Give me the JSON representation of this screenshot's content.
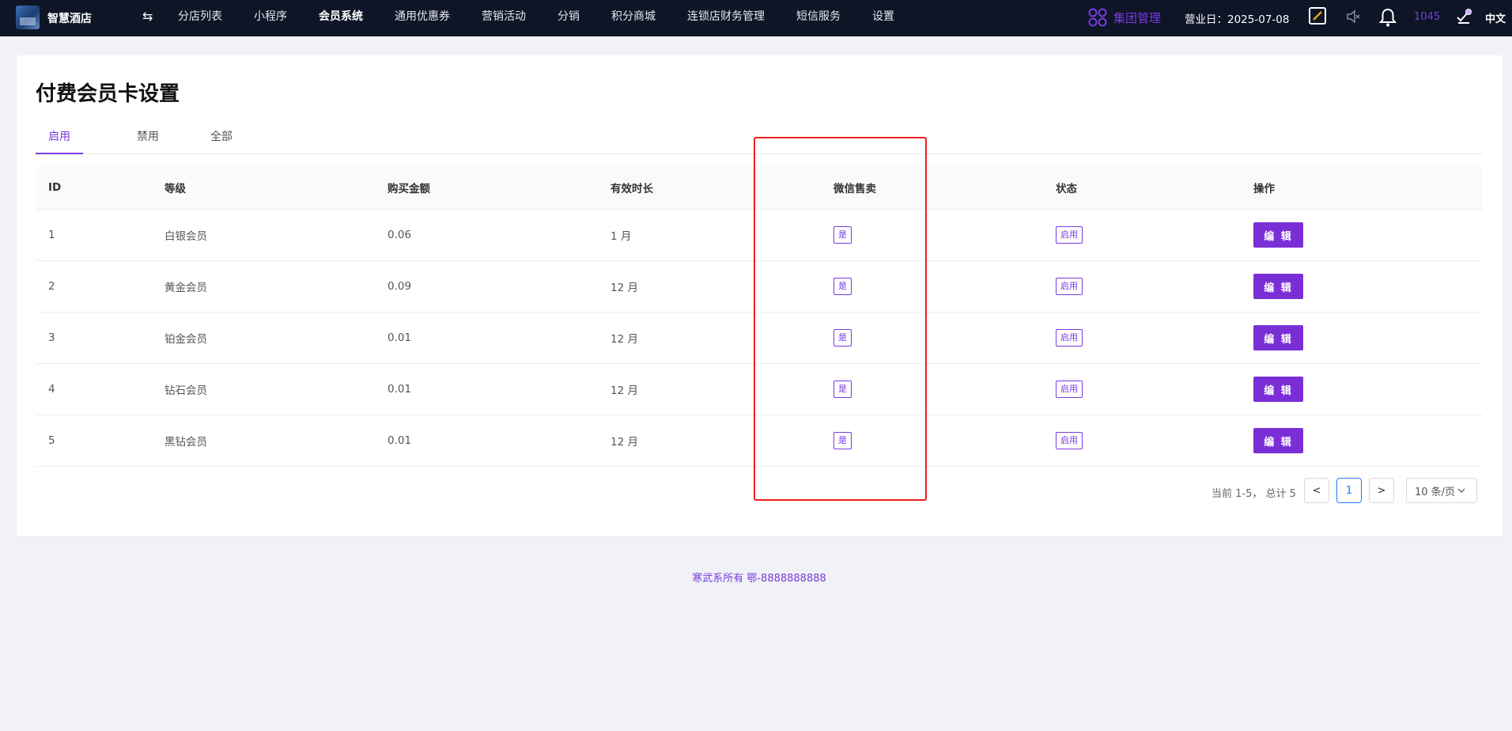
{
  "header": {
    "brand": "智慧酒店",
    "swap_icon": "⇆",
    "nav": [
      "分店列表",
      "小程序",
      "会员系统",
      "通用优惠券",
      "营销活动",
      "分销",
      "积分商城",
      "连锁店财务管理",
      "短信服务",
      "设置"
    ],
    "active_nav": "会员系统",
    "group_label": "集团管理",
    "business_date": "营业日：2025-07-08",
    "count": "1045",
    "language": "中文",
    "accent": "#7a3ae0"
  },
  "page": {
    "title": "付费会员卡设置",
    "tabs": [
      "启用",
      "禁用",
      "全部"
    ],
    "active_tab": "启用"
  },
  "table": {
    "columns": [
      "ID",
      "等级",
      "购买金额",
      "有效时长",
      "微信售卖",
      "状态",
      "操作"
    ],
    "rows": [
      {
        "id": "1",
        "level": "白银会员",
        "price": "0.06",
        "duration": "1 月",
        "wechat": "是",
        "status": "启用",
        "action": "编 辑"
      },
      {
        "id": "2",
        "level": "黄金会员",
        "price": "0.09",
        "duration": "12 月",
        "wechat": "是",
        "status": "启用",
        "action": "编 辑"
      },
      {
        "id": "3",
        "level": "铂金会员",
        "price": "0.01",
        "duration": "12 月",
        "wechat": "是",
        "status": "启用",
        "action": "编 辑"
      },
      {
        "id": "4",
        "level": "钻石会员",
        "price": "0.01",
        "duration": "12 月",
        "wechat": "是",
        "status": "启用",
        "action": "编 辑"
      },
      {
        "id": "5",
        "level": "黑钻会员",
        "price": "0.01",
        "duration": "12 月",
        "wechat": "是",
        "status": "启用",
        "action": "编 辑"
      }
    ]
  },
  "pagination": {
    "summary": "当前 1-5， 总计 5",
    "current_page": "1",
    "prev": "<",
    "next": ">",
    "page_size": "10 条/页"
  },
  "footer": {
    "text": "寒武系所有 鄂-8888888888"
  }
}
